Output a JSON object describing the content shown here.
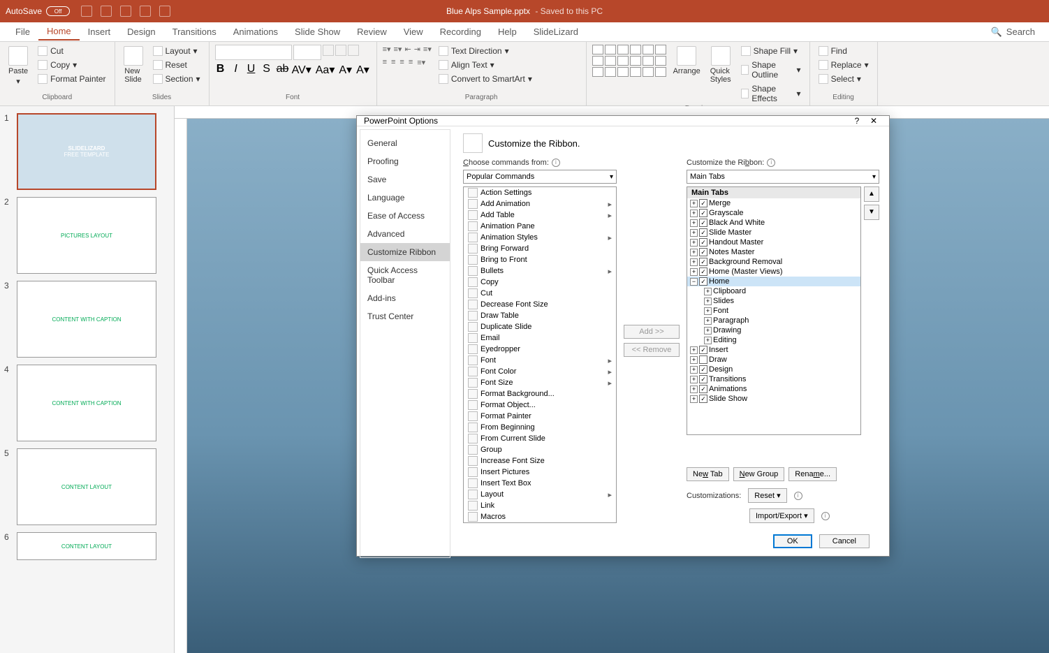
{
  "titlebar": {
    "autosave": "AutoSave",
    "autosave_state": "Off",
    "filename": "Blue Alps Sample.pptx",
    "saved_text": " -  Saved to this PC"
  },
  "tabs": [
    "File",
    "Home",
    "Insert",
    "Design",
    "Transitions",
    "Animations",
    "Slide Show",
    "Review",
    "View",
    "Recording",
    "Help",
    "SlideLizard"
  ],
  "search_placeholder": "Search",
  "ribbon": {
    "clipboard": {
      "label": "Clipboard",
      "paste": "Paste",
      "cut": "Cut",
      "copy": "Copy",
      "format_painter": "Format Painter"
    },
    "slides": {
      "label": "Slides",
      "new_slide": "New\nSlide",
      "layout": "Layout",
      "reset": "Reset",
      "section": "Section"
    },
    "font": {
      "label": "Font"
    },
    "paragraph": {
      "label": "Paragraph",
      "text_direction": "Text Direction",
      "align_text": "Align Text",
      "convert_smartart": "Convert to SmartArt"
    },
    "drawing": {
      "label": "Drawing",
      "arrange": "Arrange",
      "quick_styles": "Quick\nStyles",
      "shape_fill": "Shape Fill",
      "shape_outline": "Shape Outline",
      "shape_effects": "Shape Effects"
    },
    "editing": {
      "label": "Editing",
      "find": "Find",
      "replace": "Replace",
      "select": "Select"
    }
  },
  "thumbs": [
    {
      "n": "1",
      "title": "SLIDELIZARD",
      "sub": "FREE TEMPLATE"
    },
    {
      "n": "2",
      "title": "PICTURES LAYOUT"
    },
    {
      "n": "3",
      "title": "CONTENT WITH CAPTION"
    },
    {
      "n": "4",
      "title": "CONTENT WITH CAPTION"
    },
    {
      "n": "5",
      "title": "CONTENT LAYOUT"
    },
    {
      "n": "6",
      "title": "CONTENT LAYOUT"
    }
  ],
  "dialog": {
    "title": "PowerPoint Options",
    "help": "?",
    "close": "✕",
    "sidebar": [
      "General",
      "Proofing",
      "Save",
      "Language",
      "Ease of Access",
      "Advanced",
      "Customize Ribbon",
      "Quick Access Toolbar",
      "Add-ins",
      "Trust Center"
    ],
    "sidebar_selected": "Customize Ribbon",
    "heading": "Customize the Ribbon.",
    "choose_label": "Choose commands from:",
    "choose_value": "Popular Commands",
    "customize_label": "Customize the Ribbon:",
    "customize_value": "Main Tabs",
    "commands": [
      "Action Settings",
      "Add Animation",
      "Add Table",
      "Animation Pane",
      "Animation Styles",
      "Bring Forward",
      "Bring to Front",
      "Bullets",
      "Copy",
      "Cut",
      "Decrease Font Size",
      "Draw Table",
      "Duplicate Slide",
      "Email",
      "Eyedropper",
      "Font",
      "Font Color",
      "Font Size",
      "Format Background...",
      "Format Object...",
      "Format Painter",
      "From Beginning",
      "From Current Slide",
      "Group",
      "Increase Font Size",
      "Insert Pictures",
      "Insert Text Box",
      "Layout",
      "Link",
      "Macros"
    ],
    "commands_flyout": {
      "Add Animation": true,
      "Add Table": true,
      "Animation Styles": true,
      "Bullets": true,
      "Font": true,
      "Font Color": true,
      "Font Size": true,
      "Layout": true
    },
    "main_tabs_header": "Main Tabs",
    "tree": [
      {
        "label": "Merge",
        "checked": true,
        "exp": "+"
      },
      {
        "label": "Grayscale",
        "checked": true,
        "exp": "+"
      },
      {
        "label": "Black And White",
        "checked": true,
        "exp": "+"
      },
      {
        "label": "Slide Master",
        "checked": true,
        "exp": "+"
      },
      {
        "label": "Handout Master",
        "checked": true,
        "exp": "+"
      },
      {
        "label": "Notes Master",
        "checked": true,
        "exp": "+"
      },
      {
        "label": "Background Removal",
        "checked": true,
        "exp": "+"
      },
      {
        "label": "Home (Master Views)",
        "checked": true,
        "exp": "+"
      },
      {
        "label": "Home",
        "checked": true,
        "exp": "−",
        "selected": true,
        "children": [
          "Clipboard",
          "Slides",
          "Font",
          "Paragraph",
          "Drawing",
          "Editing"
        ]
      },
      {
        "label": "Insert",
        "checked": true,
        "exp": "+"
      },
      {
        "label": "Draw",
        "checked": false,
        "exp": "+"
      },
      {
        "label": "Design",
        "checked": true,
        "exp": "+"
      },
      {
        "label": "Transitions",
        "checked": true,
        "exp": "+"
      },
      {
        "label": "Animations",
        "checked": true,
        "exp": "+"
      },
      {
        "label": "Slide Show",
        "checked": true,
        "exp": "+"
      }
    ],
    "add_btn": "Add >>",
    "remove_btn": "<< Remove",
    "new_tab": "New Tab",
    "new_group": "New Group",
    "rename": "Rename...",
    "customizations": "Customizations:",
    "reset": "Reset",
    "import_export": "Import/Export",
    "ok": "OK",
    "cancel": "Cancel"
  }
}
